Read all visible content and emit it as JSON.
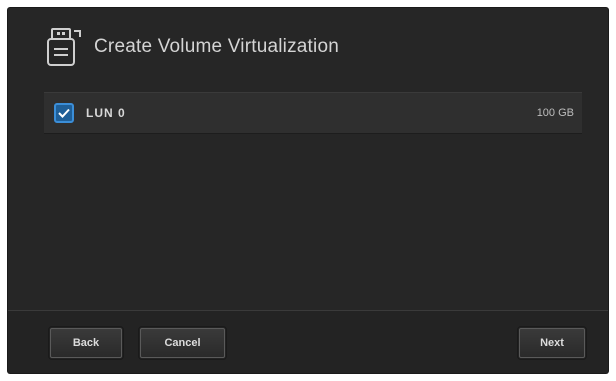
{
  "dialog": {
    "title": "Create Volume Virtualization",
    "title_icon": "usb-drive-icon"
  },
  "lun_list": [
    {
      "name": "LUN 0",
      "size": "100 GB",
      "checked": true
    }
  ],
  "footer": {
    "back_label": "Back",
    "cancel_label": "Cancel",
    "next_label": "Next"
  },
  "colors": {
    "dialog_bg": "#262626",
    "row_bg": "#2f2f2f",
    "checkbox_accent": "#3b8ed8"
  }
}
